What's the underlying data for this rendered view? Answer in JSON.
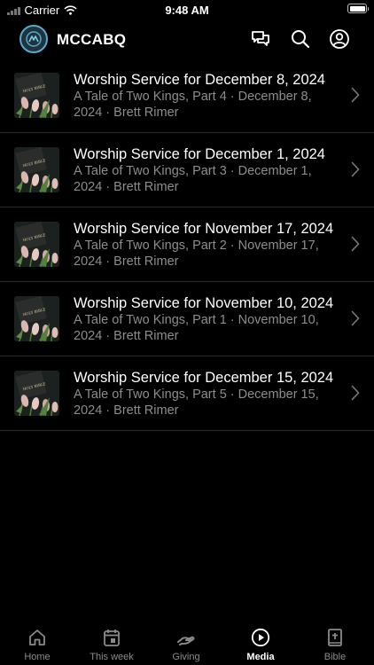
{
  "status_bar": {
    "carrier": "Carrier",
    "time": "9:48 AM"
  },
  "header": {
    "title": "MCCABQ"
  },
  "sermons": [
    {
      "title": "Worship Service for December 8, 2024",
      "subtitle": "A Tale of Two Kings, Part 4 · December 8, 2024 · Brett Rimer"
    },
    {
      "title": "Worship Service for December 1, 2024",
      "subtitle": "A Tale of Two Kings, Part 3 · December 1, 2024 · Brett Rimer"
    },
    {
      "title": "Worship Service for November 17, 2024",
      "subtitle": "A Tale of Two Kings, Part 2 · November 17, 2024 · Brett Rimer"
    },
    {
      "title": "Worship Service for November 10, 2024",
      "subtitle": "A Tale of Two Kings, Part 1 · November 10, 2024 · Brett Rimer"
    },
    {
      "title": "Worship Service for December 15, 2024",
      "subtitle": "A Tale of Two Kings, Part 5 · December 15, 2024 · Brett Rimer"
    }
  ],
  "thumbnail_text": "HOLY BIBLE",
  "tabs": [
    {
      "label": "Home",
      "icon": "home-icon"
    },
    {
      "label": "This week",
      "icon": "calendar-icon"
    },
    {
      "label": "Giving",
      "icon": "giving-hand-icon"
    },
    {
      "label": "Media",
      "icon": "play-circle-icon",
      "active": true
    },
    {
      "label": "Bible",
      "icon": "bible-icon"
    }
  ],
  "colors": {
    "background": "#000000",
    "subtitle": "#8d8d8d",
    "tab_inactive": "#8a8a8a",
    "logo_accent": "#5aa9c8"
  }
}
